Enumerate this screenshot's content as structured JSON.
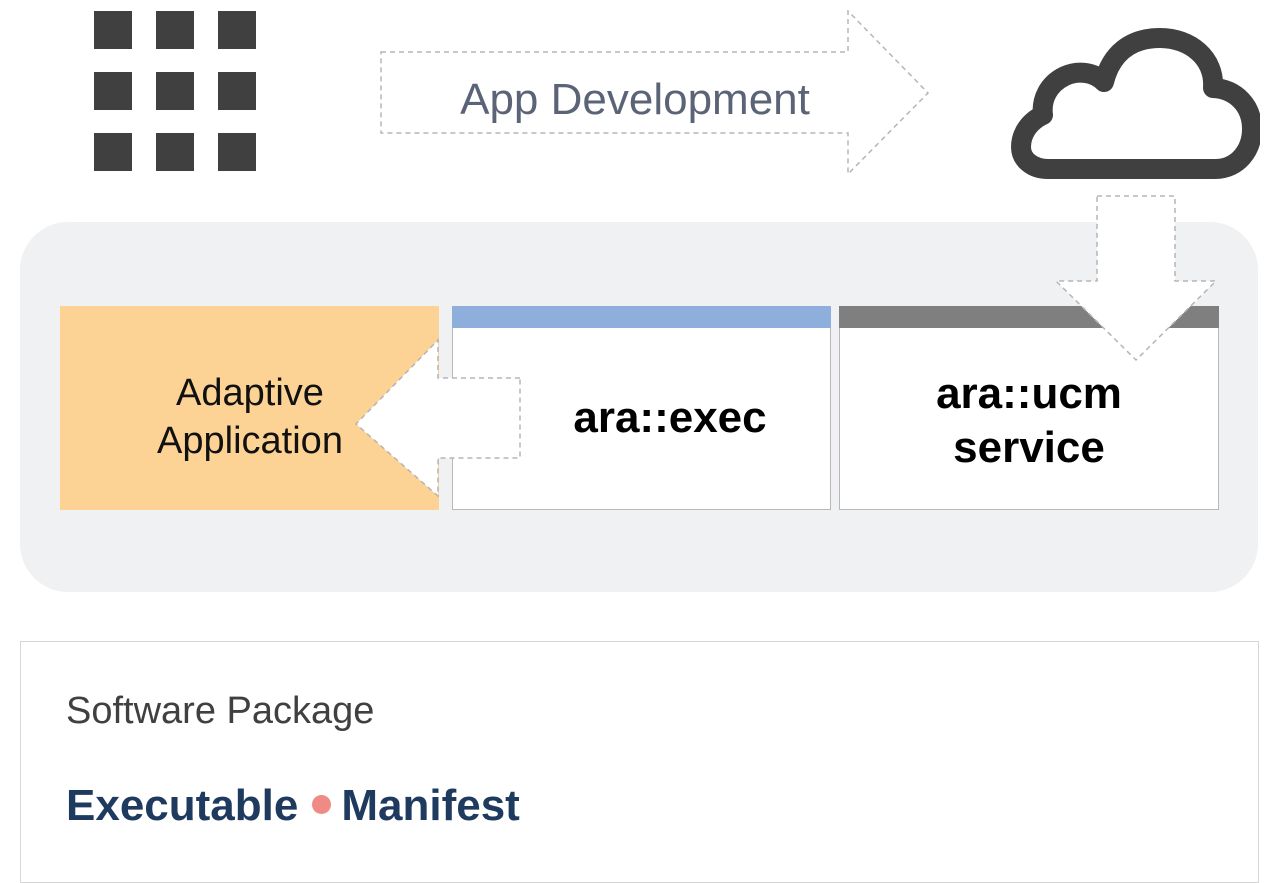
{
  "top": {
    "flow_label": "App Development",
    "source_icon": "grid-icon",
    "target_icon": "cloud-icon"
  },
  "platform": {
    "adaptive_app": {
      "line1": "Adaptive",
      "line2": "Application"
    },
    "exec_service": {
      "label": "ara::exec"
    },
    "ucm_service": {
      "line1": "ara::ucm",
      "line2": "service"
    }
  },
  "package": {
    "title": "Software Package",
    "items": [
      "Executable",
      "Manifest"
    ]
  },
  "colors": {
    "app_box": "#fcd394",
    "exec_bar": "#8eaedb",
    "ucm_bar": "#7f7f7f",
    "platform_bg": "#f0f1f3",
    "package_text": "#1f3a5f",
    "bullet": "#f08a84",
    "icon": "#404040"
  }
}
